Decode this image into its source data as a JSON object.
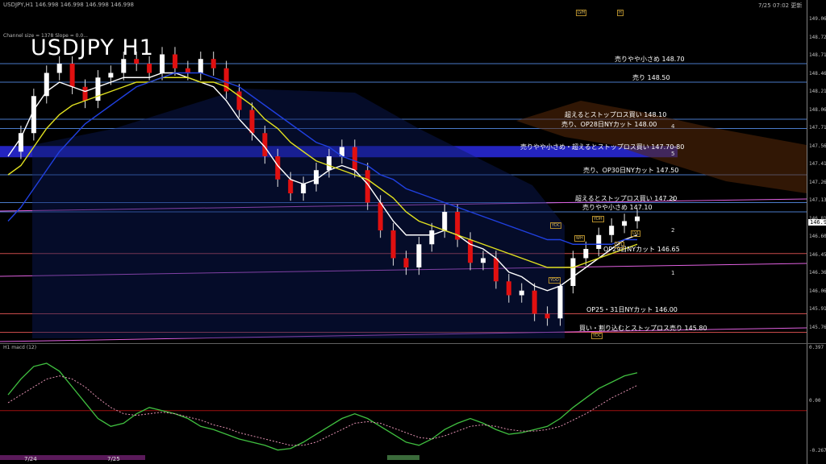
{
  "header": {
    "symbol_line": "USDJPY,H1  146.998 146.998 146.998 146.998",
    "timestamp": "7/25 07:02 更新",
    "channel_info": "Channel size = 1378 Slope = 0.0...",
    "macd_label": "H1  macd (12)"
  },
  "title": "USDJPY H1",
  "current_price": "146.998",
  "price_ticks": [
    "149.060",
    "148.720",
    "148.710",
    "148.460",
    "148.210",
    "148.060",
    "147.710",
    "147.560",
    "147.410",
    "147.260",
    "147.130",
    "146.810",
    "146.600",
    "146.450",
    "146.360",
    "146.060",
    "145.910",
    "145.760"
  ],
  "macd_ticks": [
    "0.397",
    "0.00",
    "-0.267"
  ],
  "levels": [
    {
      "label": "売りやや小さめ 148.70",
      "value": 148.7,
      "color": "#4a7ac8"
    },
    {
      "label": "売り 148.50",
      "value": 148.5,
      "color": "#4a7ac8"
    },
    {
      "label": "超えるとストップロス買い 148.10",
      "value": 148.1,
      "color": "#4a7ac8"
    },
    {
      "label": "売り、OP28日NYカット 148.00",
      "value": 148.0,
      "color": "#4a7ac8"
    },
    {
      "label": "売りやや小さめ・超えるとストップロス買い 147.70-80",
      "value": 147.75,
      "color": "#2a2ae0"
    },
    {
      "label": "売り、OP30日NYカット 147.50",
      "value": 147.5,
      "color": "#4a7ac8"
    },
    {
      "label": "超えるとストップロス買い 147.20",
      "value": 147.2,
      "color": "#4a7ac8"
    },
    {
      "label": "売りやや小さめ 147.10",
      "value": 147.1,
      "color": "#4a7ac8"
    },
    {
      "label": "OP29日NYカット 146.65",
      "value": 146.65,
      "color": "#c84a4a"
    },
    {
      "label": "OP25・31日NYカット 146.00",
      "value": 146.0,
      "color": "#c84a4a"
    },
    {
      "label": "買い・割り込むとストップロス売り 145.80",
      "value": 145.8,
      "color": "#c84a4a"
    }
  ],
  "channel_numbers": [
    "4",
    "5",
    "3",
    "2",
    "1"
  ],
  "x_labels": [
    "7/24",
    "7/25"
  ],
  "tags": [
    "LVH",
    "H",
    "YDC",
    "YDH",
    "WH",
    "LVL",
    "YDO",
    "LVL",
    "YDC"
  ],
  "chart_data": {
    "type": "line",
    "title": "USDJPY H1",
    "ylim": [
      145.7,
      149.3
    ],
    "series": [
      {
        "values": [
          147.75,
          147.95,
          148.35,
          148.6,
          148.7,
          148.45,
          148.3,
          148.55,
          148.6,
          148.75,
          148.7,
          148.6,
          148.8,
          148.65,
          148.6,
          148.75,
          148.65,
          148.4,
          148.2,
          147.95,
          147.7,
          147.45,
          147.3,
          147.4,
          147.55,
          147.7,
          147.8,
          147.55,
          147.2,
          146.9,
          146.6,
          146.5,
          146.75,
          146.9,
          147.1,
          146.8,
          146.55,
          146.6,
          146.35,
          146.2,
          146.25,
          146.0,
          145.95,
          146.3,
          146.6,
          146.7,
          146.85,
          146.95,
          147.0,
          147.05
        ]
      },
      {
        "values": [
          147.7,
          147.9,
          148.2,
          148.4,
          148.5,
          148.45,
          148.4,
          148.45,
          148.5,
          148.55,
          148.55,
          148.55,
          148.6,
          148.6,
          148.55,
          148.5,
          148.45,
          148.3,
          148.1,
          147.95,
          147.8,
          147.6,
          147.45,
          147.4,
          147.45,
          147.55,
          147.6,
          147.55,
          147.4,
          147.2,
          147.0,
          146.85,
          146.85,
          146.85,
          146.9,
          146.85,
          146.75,
          146.7,
          146.6,
          146.45,
          146.4,
          146.3,
          146.25,
          146.3,
          146.4,
          146.5,
          146.6,
          146.7,
          146.8,
          146.85
        ]
      },
      {
        "values": [
          147.5,
          147.6,
          147.8,
          148.0,
          148.15,
          148.25,
          148.3,
          148.35,
          148.4,
          148.45,
          148.5,
          148.5,
          148.55,
          148.55,
          148.55,
          148.5,
          148.5,
          148.45,
          148.35,
          148.25,
          148.1,
          148.0,
          147.85,
          147.75,
          147.65,
          147.6,
          147.55,
          147.5,
          147.45,
          147.35,
          147.25,
          147.1,
          147.0,
          146.95,
          146.9,
          146.85,
          146.8,
          146.75,
          146.7,
          146.65,
          146.6,
          146.55,
          146.5,
          146.5,
          146.5,
          146.55,
          146.6,
          146.65,
          146.7,
          146.75
        ]
      },
      {
        "values": [
          147.0,
          147.15,
          147.35,
          147.55,
          147.75,
          147.9,
          148.05,
          148.15,
          148.25,
          148.35,
          148.45,
          148.5,
          148.55,
          148.6,
          148.6,
          148.6,
          148.55,
          148.5,
          148.45,
          148.35,
          148.25,
          148.15,
          148.05,
          147.95,
          147.85,
          147.8,
          147.7,
          147.65,
          147.6,
          147.5,
          147.45,
          147.35,
          147.3,
          147.25,
          147.2,
          147.15,
          147.1,
          147.05,
          147.0,
          146.95,
          146.9,
          146.85,
          146.8,
          146.8,
          146.75,
          146.75,
          146.75,
          146.75,
          146.8,
          146.8
        ]
      }
    ],
    "macd": {
      "ylim": [
        -0.267,
        0.397
      ],
      "main": [
        0.1,
        0.2,
        0.28,
        0.3,
        0.25,
        0.15,
        0.05,
        -0.05,
        -0.1,
        -0.08,
        -0.02,
        0.02,
        0.0,
        -0.02,
        -0.05,
        -0.1,
        -0.12,
        -0.15,
        -0.18,
        -0.2,
        -0.22,
        -0.25,
        -0.24,
        -0.2,
        -0.15,
        -0.1,
        -0.05,
        -0.02,
        -0.05,
        -0.1,
        -0.15,
        -0.2,
        -0.22,
        -0.18,
        -0.12,
        -0.08,
        -0.05,
        -0.08,
        -0.12,
        -0.15,
        -0.14,
        -0.12,
        -0.1,
        -0.05,
        0.02,
        0.08,
        0.14,
        0.18,
        0.22,
        0.24
      ],
      "signal": [
        0.05,
        0.1,
        0.15,
        0.2,
        0.22,
        0.2,
        0.15,
        0.08,
        0.02,
        -0.02,
        -0.03,
        -0.02,
        -0.01,
        -0.02,
        -0.04,
        -0.06,
        -0.09,
        -0.11,
        -0.14,
        -0.16,
        -0.18,
        -0.2,
        -0.22,
        -0.22,
        -0.2,
        -0.16,
        -0.12,
        -0.08,
        -0.07,
        -0.08,
        -0.11,
        -0.14,
        -0.17,
        -0.18,
        -0.16,
        -0.13,
        -0.1,
        -0.09,
        -0.1,
        -0.12,
        -0.13,
        -0.13,
        -0.12,
        -0.1,
        -0.06,
        -0.02,
        0.03,
        0.08,
        0.12,
        0.16
      ]
    }
  }
}
